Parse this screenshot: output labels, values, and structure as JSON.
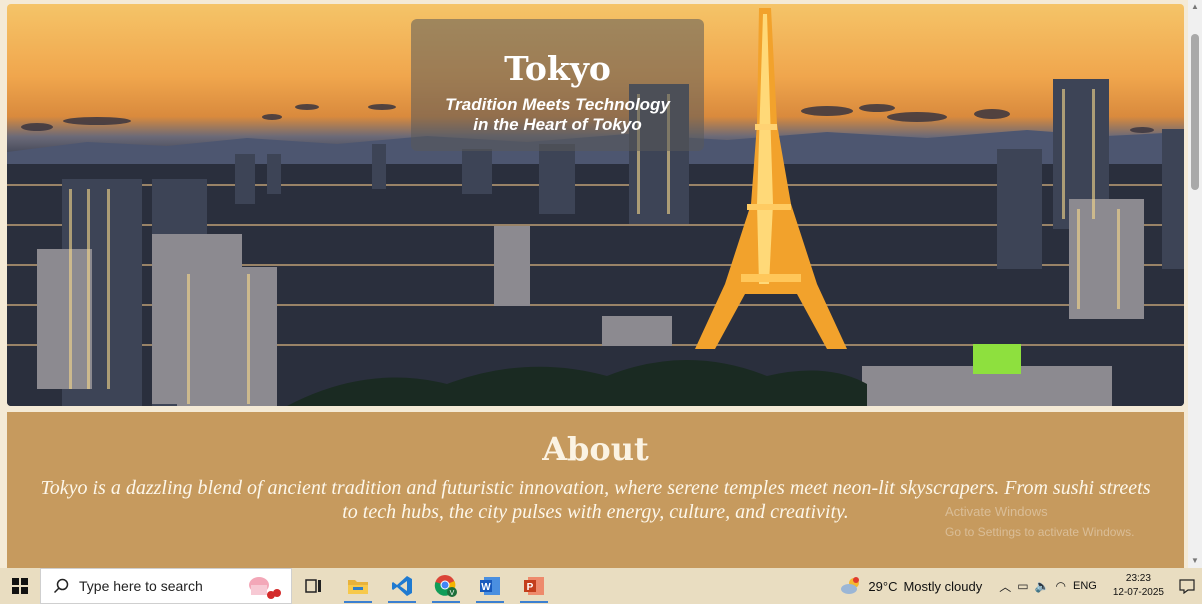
{
  "hero": {
    "title": "Tokyo",
    "subtitle_line1": "Tradition Meets Technology",
    "subtitle_line2": "in the Heart of Tokyo"
  },
  "about": {
    "title": "About",
    "text": "Tokyo is a dazzling blend of ancient tradition and futuristic innovation, where serene temples meet neon-lit skyscrapers. From sushi streets to tech hubs, the city pulses with energy, culture, and creativity."
  },
  "watermark": {
    "line1": "Activate Windows",
    "line2": "Go to Settings to activate Windows."
  },
  "taskbar": {
    "search_placeholder": "Type here to search",
    "apps": [
      {
        "name": "task-view-icon"
      },
      {
        "name": "file-explorer-icon"
      },
      {
        "name": "vscode-icon"
      },
      {
        "name": "chrome-icon"
      },
      {
        "name": "word-icon"
      },
      {
        "name": "powerpoint-icon"
      }
    ],
    "weather_temp": "29°C",
    "weather_desc": "Mostly cloudy",
    "language": "ENG",
    "time": "23:23",
    "date": "12-07-2025"
  },
  "colors": {
    "about_bg": "#c69a5e",
    "taskbar_bg": "#e9ddc1",
    "accent": "#3b7fd0"
  }
}
